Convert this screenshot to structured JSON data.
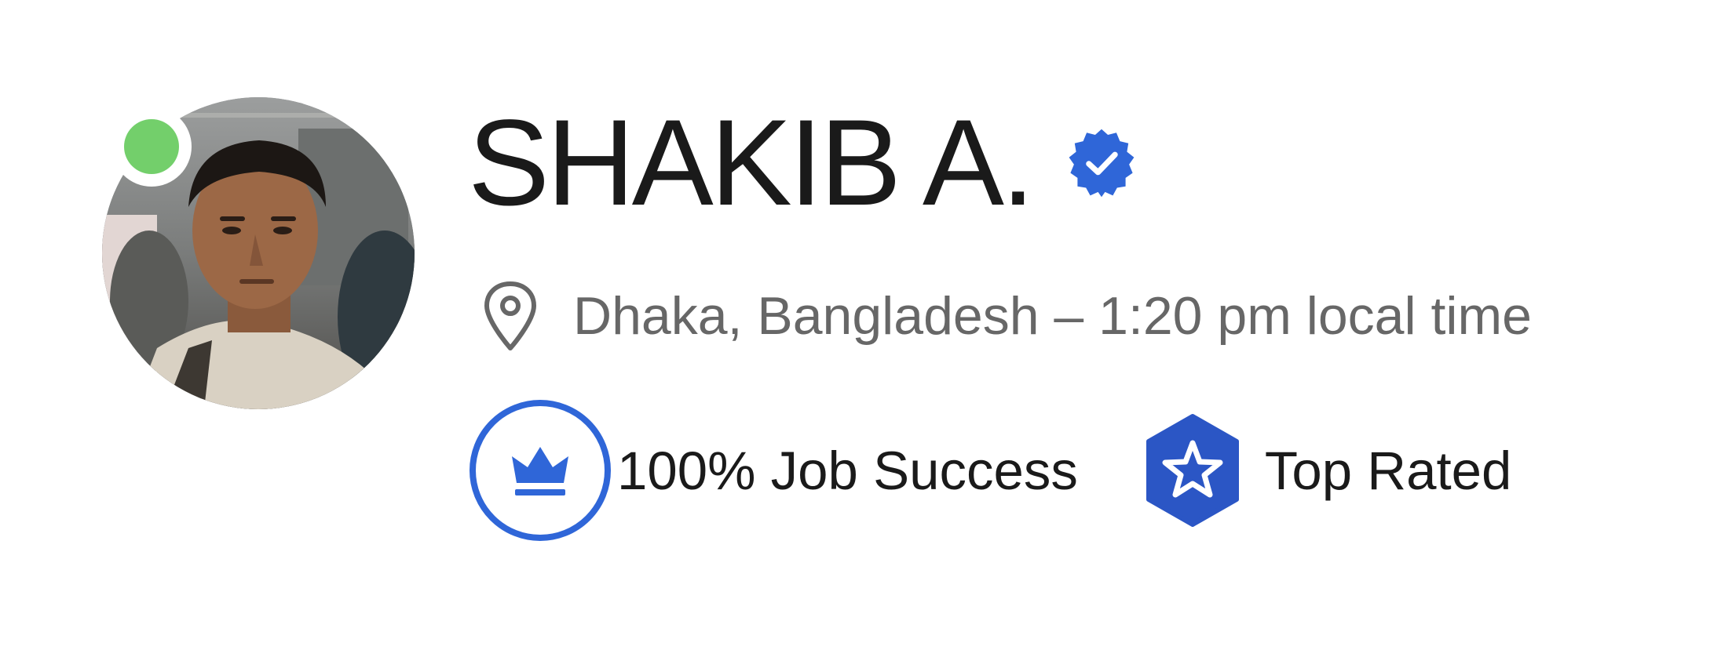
{
  "profile": {
    "name": "SHAKIB A.",
    "verified_icon": "verified-badge-icon",
    "online_status_icon": "online-status-dot",
    "location_icon": "map-pin-icon",
    "location": "Dhaka, Bangladesh – 1:20 pm local time"
  },
  "badges": {
    "job_success": {
      "icon": "crown-icon",
      "label": "100% Job Success"
    },
    "top_rated": {
      "icon": "star-icon",
      "label": "Top Rated"
    }
  },
  "colors": {
    "accent_blue": "#2f66d8",
    "top_rated_blue": "#2b56c5",
    "online_green": "#73cf6b",
    "text_primary": "#1a1a1a",
    "text_secondary": "#676767"
  }
}
